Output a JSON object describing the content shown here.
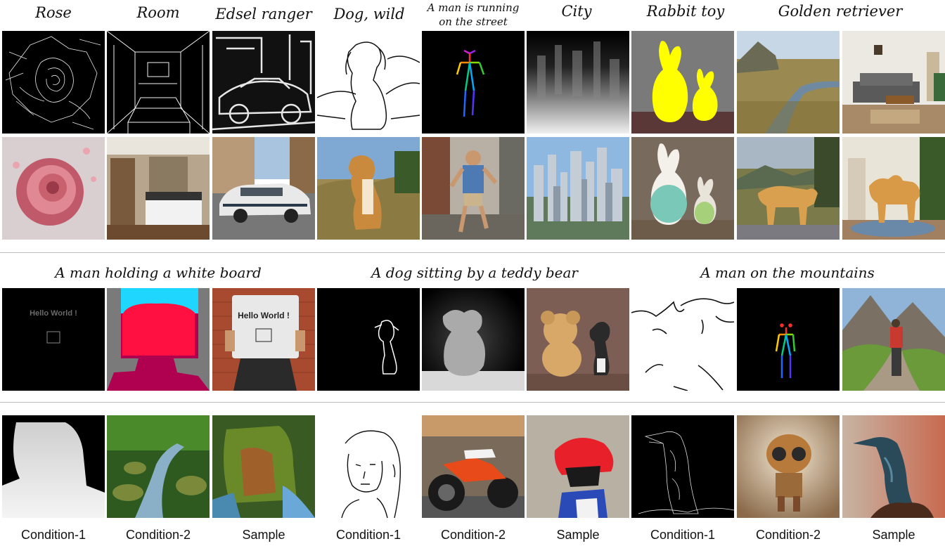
{
  "section1": {
    "captions": [
      "Rose",
      "Room",
      "Edsel ranger",
      "Dog, wild",
      "A man is running on the street",
      "City",
      "Rabbit toy",
      "Golden retriever"
    ],
    "caption_running_line1": "A man is running",
    "caption_running_line2": "on the street"
  },
  "section2": {
    "captions": [
      "A man holding a white board",
      "A dog sitting by a teddy bear",
      "A man on the mountains"
    ],
    "board_text": "Hello World !"
  },
  "section3": {
    "labels": [
      "Condition-1",
      "Condition-2",
      "Sample",
      "Condition-1",
      "Condition-2",
      "Sample",
      "Condition-1",
      "Condition-2",
      "Sample"
    ]
  }
}
